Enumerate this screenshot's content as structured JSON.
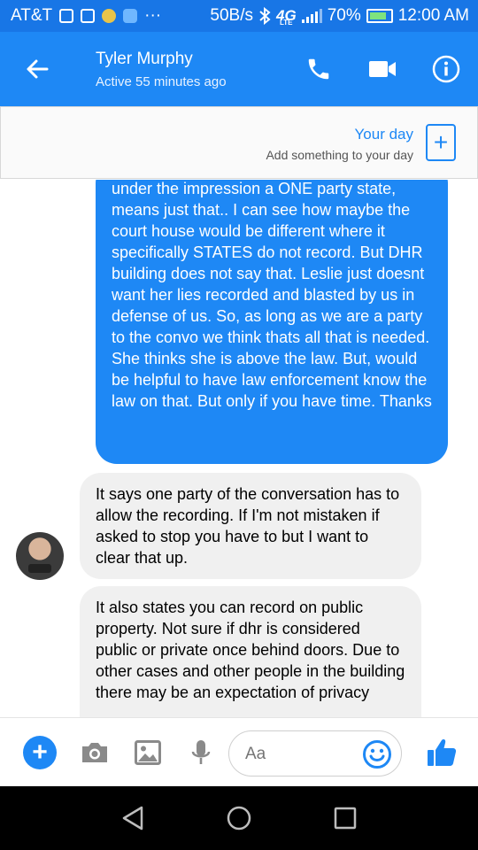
{
  "status_bar": {
    "carrier": "AT&T",
    "more": "···",
    "net_speed": "50B/s",
    "network": "4G",
    "network_sub": "LTE",
    "battery": "70%",
    "time": "12:00 AM"
  },
  "header": {
    "contact_name": "Tyler Murphy",
    "contact_status": "Active 55 minutes ago",
    "icons": [
      "back-arrow-icon",
      "phone-icon",
      "video-camera-icon",
      "info-icon"
    ]
  },
  "your_day": {
    "title": "Your day",
    "subtitle": "Add something to your day",
    "add_symbol": "+"
  },
  "messages": [
    {
      "sender": "me",
      "text": "under the impression a ONE party state, means just that.. I can see how maybe the court house would be different where it specifically STATES do not record. But DHR building does not say that. Leslie just doesnt want her lies recorded and blasted by us in defense of us. So, as long as we are a party to the convo we think thats all that is needed. She thinks she is above the law. But, would be helpful to have law enforcement know the law on that. But only if you have time. Thanks"
    },
    {
      "sender": "contact",
      "text": "It says one party of the conversation has to allow the recording. If I'm not mistaken if asked to stop you have to but I want to clear that up."
    },
    {
      "sender": "contact",
      "text": "It also states you can record on public property. Not sure if dhr is considered public or private once behind doors. Due to other cases and other people in the building there may be an expectation of privacy"
    }
  ],
  "composer": {
    "placeholder": "Aa",
    "add_symbol": "+",
    "icons": [
      "plus-icon",
      "camera-icon",
      "image-icon",
      "microphone-icon",
      "emoji-icon",
      "thumbs-up-icon"
    ]
  },
  "colors": {
    "accent": "#1e88f5",
    "status_bar": "#1876e6",
    "incoming_bubble": "#f0f0f0"
  }
}
